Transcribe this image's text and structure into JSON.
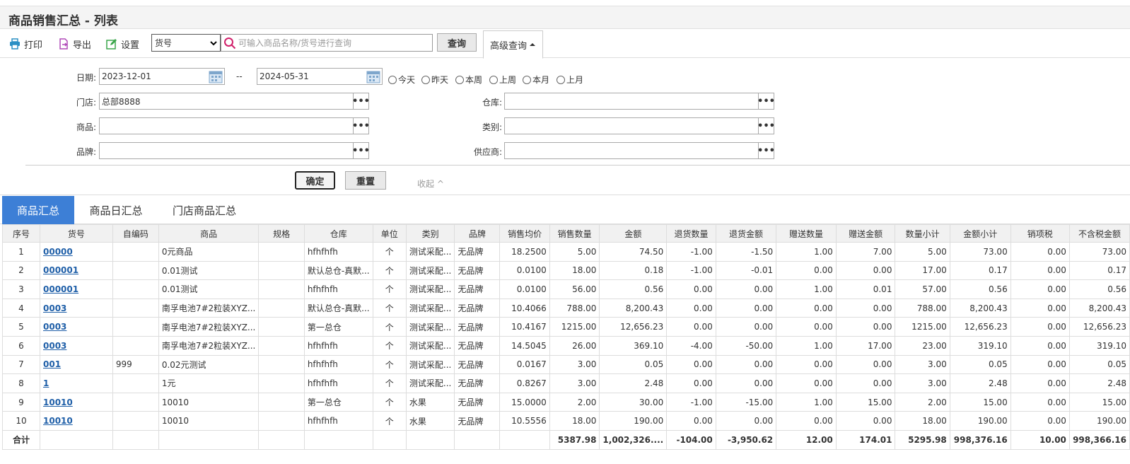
{
  "header": {
    "title": "商品销售汇总 - 列表"
  },
  "toolbar": {
    "print_label": "打印",
    "export_label": "导出",
    "settings_label": "设置",
    "search_field_selected": "货号",
    "search_placeholder": "可输入商品名称/货号进行查询",
    "query_label": "查询",
    "advanced_label": "高级查询"
  },
  "filter": {
    "date_label": "日期:",
    "date_from": "2023-12-01",
    "date_sep": "--",
    "date_to": "2024-05-31",
    "radios": [
      "今天",
      "昨天",
      "本周",
      "上周",
      "本月",
      "上月"
    ],
    "store_label": "门店:",
    "store_value": "总部8888",
    "warehouse_label": "仓库:",
    "product_label": "商品:",
    "category_label": "类别:",
    "brand_label": "品牌:",
    "supplier_label": "供应商:",
    "dots": "•••",
    "confirm_label": "确定",
    "reset_label": "重置",
    "collapse_label": "收起 ^"
  },
  "tabs": [
    "商品汇总",
    "商品日汇总",
    "门店商品汇总"
  ],
  "table": {
    "columns": [
      "序号",
      "货号",
      "自编码",
      "商品",
      "规格",
      "仓库",
      "单位",
      "类别",
      "品牌",
      "销售均价",
      "销售数量",
      "金额",
      "退货数量",
      "退货金额",
      "赠送数量",
      "赠送金额",
      "数量小计",
      "金额小计",
      "销项税",
      "不含税金额"
    ],
    "rows": [
      [
        "1",
        "00000",
        "",
        "0元商品",
        "",
        "hfhfhfh",
        "个",
        "测试采配...",
        "无品牌",
        "18.2500",
        "5.00",
        "74.50",
        "-1.00",
        "-1.50",
        "1.00",
        "7.00",
        "5.00",
        "73.00",
        "0.00",
        "73.00"
      ],
      [
        "2",
        "000001",
        "",
        "0.01测试",
        "",
        "默认总仓-真默...",
        "个",
        "测试采配...",
        "无品牌",
        "0.0100",
        "18.00",
        "0.18",
        "-1.00",
        "-0.01",
        "0.00",
        "0.00",
        "17.00",
        "0.17",
        "0.00",
        "0.17"
      ],
      [
        "3",
        "000001",
        "",
        "0.01测试",
        "",
        "hfhfhfh",
        "个",
        "测试采配...",
        "无品牌",
        "0.0100",
        "56.00",
        "0.56",
        "0.00",
        "0.00",
        "1.00",
        "0.01",
        "57.00",
        "0.56",
        "0.00",
        "0.56"
      ],
      [
        "4",
        "0003",
        "",
        "南孚电池7#2粒装XYZ...",
        "",
        "默认总仓-真默...",
        "个",
        "测试采配...",
        "无品牌",
        "10.4066",
        "788.00",
        "8,200.43",
        "0.00",
        "0.00",
        "0.00",
        "0.00",
        "788.00",
        "8,200.43",
        "0.00",
        "8,200.43"
      ],
      [
        "5",
        "0003",
        "",
        "南孚电池7#2粒装XYZ...",
        "",
        "第一总仓",
        "个",
        "测试采配...",
        "无品牌",
        "10.4167",
        "1215.00",
        "12,656.23",
        "0.00",
        "0.00",
        "0.00",
        "0.00",
        "1215.00",
        "12,656.23",
        "0.00",
        "12,656.23"
      ],
      [
        "6",
        "0003",
        "",
        "南孚电池7#2粒装XYZ...",
        "",
        "hfhfhfh",
        "个",
        "测试采配...",
        "无品牌",
        "14.5045",
        "26.00",
        "369.10",
        "-4.00",
        "-50.00",
        "1.00",
        "17.00",
        "23.00",
        "319.10",
        "0.00",
        "319.10"
      ],
      [
        "7",
        "001",
        "999",
        "0.02元测试",
        "",
        "hfhfhfh",
        "个",
        "测试采配...",
        "无品牌",
        "0.0167",
        "3.00",
        "0.05",
        "0.00",
        "0.00",
        "0.00",
        "0.00",
        "3.00",
        "0.05",
        "0.00",
        "0.05"
      ],
      [
        "8",
        "1",
        "",
        "1元",
        "",
        "hfhfhfh",
        "个",
        "测试采配...",
        "无品牌",
        "0.8267",
        "3.00",
        "2.48",
        "0.00",
        "0.00",
        "0.00",
        "0.00",
        "3.00",
        "2.48",
        "0.00",
        "2.48"
      ],
      [
        "9",
        "10010",
        "",
        "10010",
        "",
        "第一总仓",
        "个",
        "水果",
        "无品牌",
        "15.0000",
        "2.00",
        "30.00",
        "-1.00",
        "-15.00",
        "1.00",
        "15.00",
        "2.00",
        "15.00",
        "0.00",
        "15.00"
      ],
      [
        "10",
        "10010",
        "",
        "10010",
        "",
        "hfhfhfh",
        "个",
        "水果",
        "无品牌",
        "10.5556",
        "18.00",
        "190.00",
        "0.00",
        "0.00",
        "0.00",
        "0.00",
        "18.00",
        "190.00",
        "0.00",
        "190.00"
      ]
    ],
    "total": [
      "合计",
      "",
      "",
      "",
      "",
      "",
      "",
      "",
      "",
      "",
      "5387.98",
      "1,002,326....",
      "-104.00",
      "-3,950.62",
      "12.00",
      "174.01",
      "5295.98",
      "998,376.16",
      "10.00",
      "998,366.16"
    ]
  },
  "colors": {
    "accent": "#3d7fd6",
    "link": "#1f5fa8",
    "print_icon": "#2a8fc4",
    "export_icon": "#b04ab8",
    "settings_icon": "#3aa64a"
  },
  "icons": [
    "printer-icon",
    "export-icon",
    "edit-icon",
    "search-icon",
    "calendar-icon",
    "chevron-up-icon"
  ]
}
